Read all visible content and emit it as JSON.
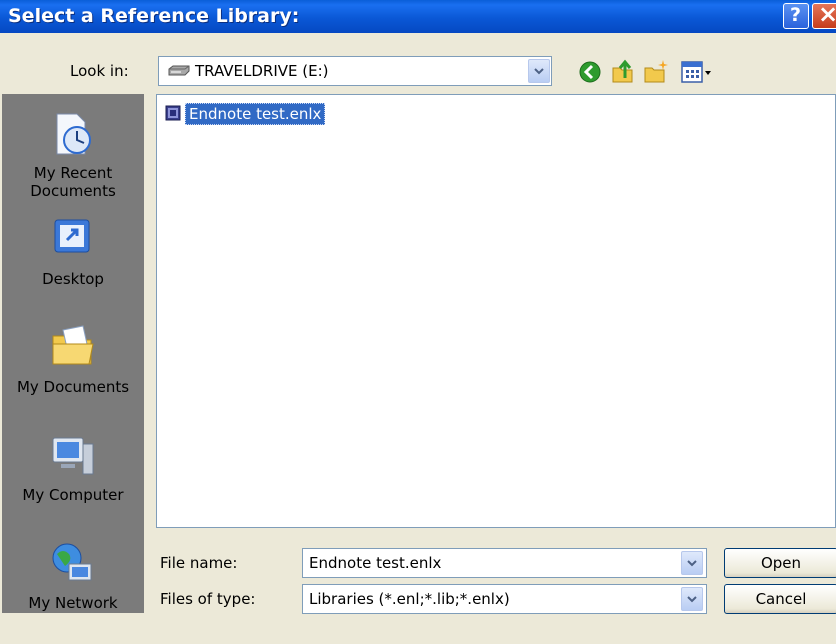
{
  "window": {
    "title": "Select a Reference Library:",
    "help_glyph": "?",
    "close_glyph": "×"
  },
  "look_in": {
    "label": "Look in:",
    "value": "TRAVELDRIVE (E:)",
    "drive_icon": "drive-icon"
  },
  "toolbar": {
    "icons": [
      "back-icon",
      "up-folder-icon",
      "new-folder-icon",
      "views-icon"
    ]
  },
  "places": [
    {
      "label": "My Recent Documents",
      "icon": "recent-documents-icon"
    },
    {
      "label": "Desktop",
      "icon": "desktop-icon"
    },
    {
      "label": "My Documents",
      "icon": "my-documents-icon"
    },
    {
      "label": "My Computer",
      "icon": "my-computer-icon"
    },
    {
      "label": "My Network",
      "icon": "my-network-icon"
    }
  ],
  "files": [
    {
      "name": "Endnote test.enlx",
      "selected": true
    }
  ],
  "file_name": {
    "label": "File name:",
    "value": "Endnote test.enlx"
  },
  "file_type": {
    "label": "Files of type:",
    "value": "Libraries (*.enl;*.lib;*.enlx)"
  },
  "buttons": {
    "open": "Open",
    "cancel": "Cancel"
  },
  "colors": {
    "title_bar": "#0a58d6",
    "selection": "#316ac5",
    "dialog_bg": "#ece9d8",
    "places_bar": "#7b7b7b"
  }
}
